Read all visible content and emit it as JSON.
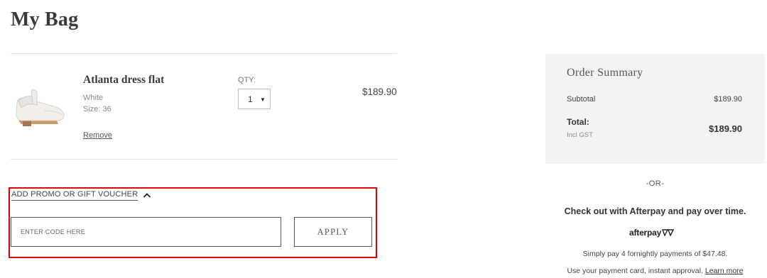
{
  "page": {
    "title": "My Bag"
  },
  "cart": {
    "items": [
      {
        "name": "Atlanta dress flat",
        "color": "White",
        "size": "Size: 36",
        "remove_label": "Remove",
        "qty_label": "QTY:",
        "qty_value": "1",
        "price": "$189.90",
        "image_icon": "shoe-image"
      }
    ]
  },
  "promo": {
    "toggle_label": "ADD PROMO OR GIFT VOUCHER",
    "toggle_icon": "chevron-up-icon",
    "placeholder": "ENTER CODE HERE",
    "apply_label": "APPLY",
    "highlight_color": "#e10000"
  },
  "summary": {
    "title": "Order Summary",
    "subtotal_label": "Subtotal",
    "subtotal_value": "$189.90",
    "total_label": "Total:",
    "total_note": "Incl GST",
    "total_value": "$189.90"
  },
  "afterpay": {
    "or_text": "-OR-",
    "headline": "Check out with Afterpay and pay over time.",
    "logo_text": "afterpay",
    "installments": "Simply pay 4 fornightly payments of $47.48.",
    "approval_text": "Use your payment card, instant approval.",
    "learn_more_label": "Learn more"
  }
}
